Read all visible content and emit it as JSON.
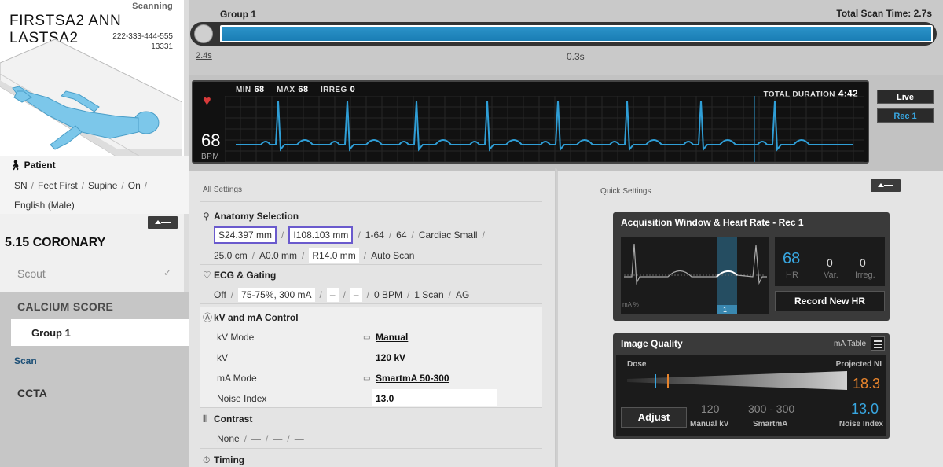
{
  "patient": {
    "status": "Scanning",
    "name": "FIRSTSA2 ANN LASTSA2",
    "id": "222-333-444-555",
    "exam": "13331",
    "section_title": "Patient",
    "info": [
      "SN",
      "Feet First",
      "Supine",
      "On"
    ],
    "language": "English (Male)"
  },
  "protocol": {
    "name": "5.15 CORONARY",
    "scout": "Scout",
    "calcium_title": "CALCIUM SCORE",
    "group": "Group 1",
    "scan": "Scan",
    "ccta": "CCTA"
  },
  "scanbar": {
    "group": "Group 1",
    "total": "Total Scan Time: 2.7s",
    "progress": 1.0,
    "time_left": "2.4s",
    "time_right": "0.3s"
  },
  "ecg": {
    "min_label": "MIN",
    "min": "68",
    "max_label": "MAX",
    "max": "68",
    "irreg_label": "IRREG",
    "irreg": "0",
    "total_duration_label": "TOTAL DURATION",
    "total_duration": "4:42",
    "hr": "68",
    "hr_unit": "BPM",
    "live": "Live",
    "rec": "Rec 1",
    "wave_color": "#2f9ed6"
  },
  "settings": {
    "header": "All Settings",
    "anatomy": {
      "title": "Anatomy Selection",
      "s": "S24.397 mm",
      "i": "I108.103 mm",
      "rows": "1-64",
      "ch": "64",
      "sfov": "Cardiac Small",
      "thick": "25.0 cm",
      "a": "A0.0 mm",
      "r": "R14.0 mm",
      "auto": "Auto Scan"
    },
    "ecg": {
      "title": "ECG & Gating",
      "off": "Off",
      "phase": "75-75%, 300 mA",
      "d1": "–",
      "d2": "–",
      "bpm": "0 BPM",
      "scan": "1 Scan",
      "ag": "AG"
    },
    "kvma": {
      "title": "kV and mA Control",
      "kv_mode_label": "kV Mode",
      "kv_mode": "Manual",
      "kv_label": "kV",
      "kv": "120 kV",
      "ma_mode_label": "mA Mode",
      "ma_mode": "SmartmA 50-300",
      "noise_label": "Noise Index",
      "noise": "13.0"
    },
    "contrast": {
      "title": "Contrast",
      "none": "None",
      "d1": "—",
      "d2": "—",
      "d3": "—"
    },
    "timing": {
      "title": "Timing"
    }
  },
  "quick": {
    "header": "Quick Settings",
    "acq": {
      "title": "Acquisition Window & Heart Rate - Rec 1",
      "ma_label": "mA %",
      "phase_num": "1",
      "hr": "68",
      "hr_label": "HR",
      "var": "0",
      "var_label": "Var.",
      "irreg": "0",
      "irreg_label": "Irreg.",
      "record": "Record New HR"
    },
    "iq": {
      "title": "Image Quality",
      "ma_table": "mA Table",
      "dose": "Dose",
      "projected_label": "Projected NI",
      "projected": "18.3",
      "adjust": "Adjust",
      "kv": "120",
      "kv_label": "Manual kV",
      "sma": "300 - 300",
      "sma_label": "SmartmA",
      "ni": "13.0",
      "ni_label": "Noise Index"
    }
  }
}
